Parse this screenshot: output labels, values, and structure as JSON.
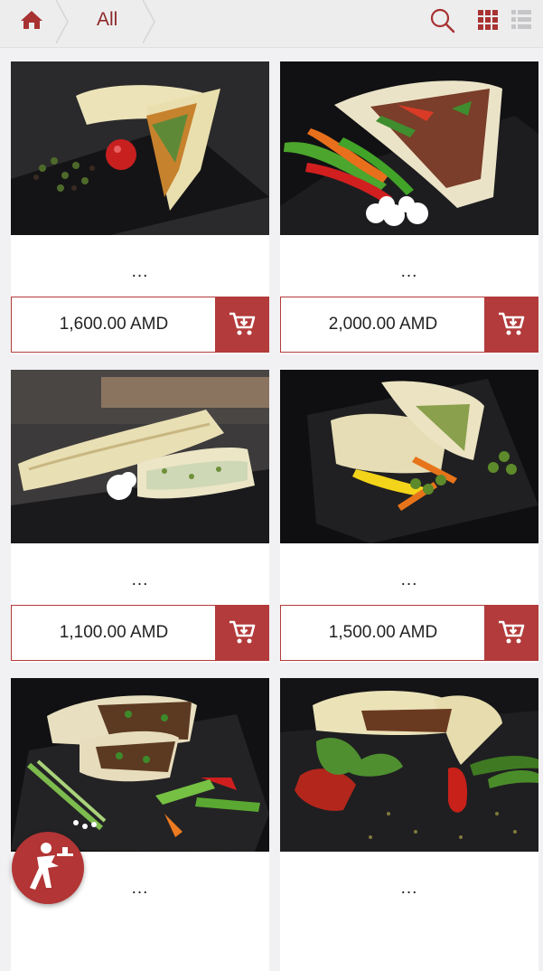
{
  "breadcrumb": {
    "home_icon": "home-icon",
    "current": "All"
  },
  "toolbar": {
    "search_icon": "search-icon",
    "grid_view_icon": "grid-view-icon",
    "list_view_icon": "list-view-icon"
  },
  "colors": {
    "accent": "#b33b3b",
    "brand_dark": "#8e2a2a",
    "background": "#f1f1f3"
  },
  "products": [
    {
      "name": "...",
      "price": "1,600.00 AMD"
    },
    {
      "name": "...",
      "price": "2,000.00 AMD"
    },
    {
      "name": "...",
      "price": "1,100.00 AMD"
    },
    {
      "name": "...",
      "price": "1,500.00 AMD"
    },
    {
      "name": "...",
      "price": ""
    },
    {
      "name": "...",
      "price": ""
    }
  ],
  "cart_icon": "add-to-cart-icon",
  "fab_icon": "waiter-icon"
}
